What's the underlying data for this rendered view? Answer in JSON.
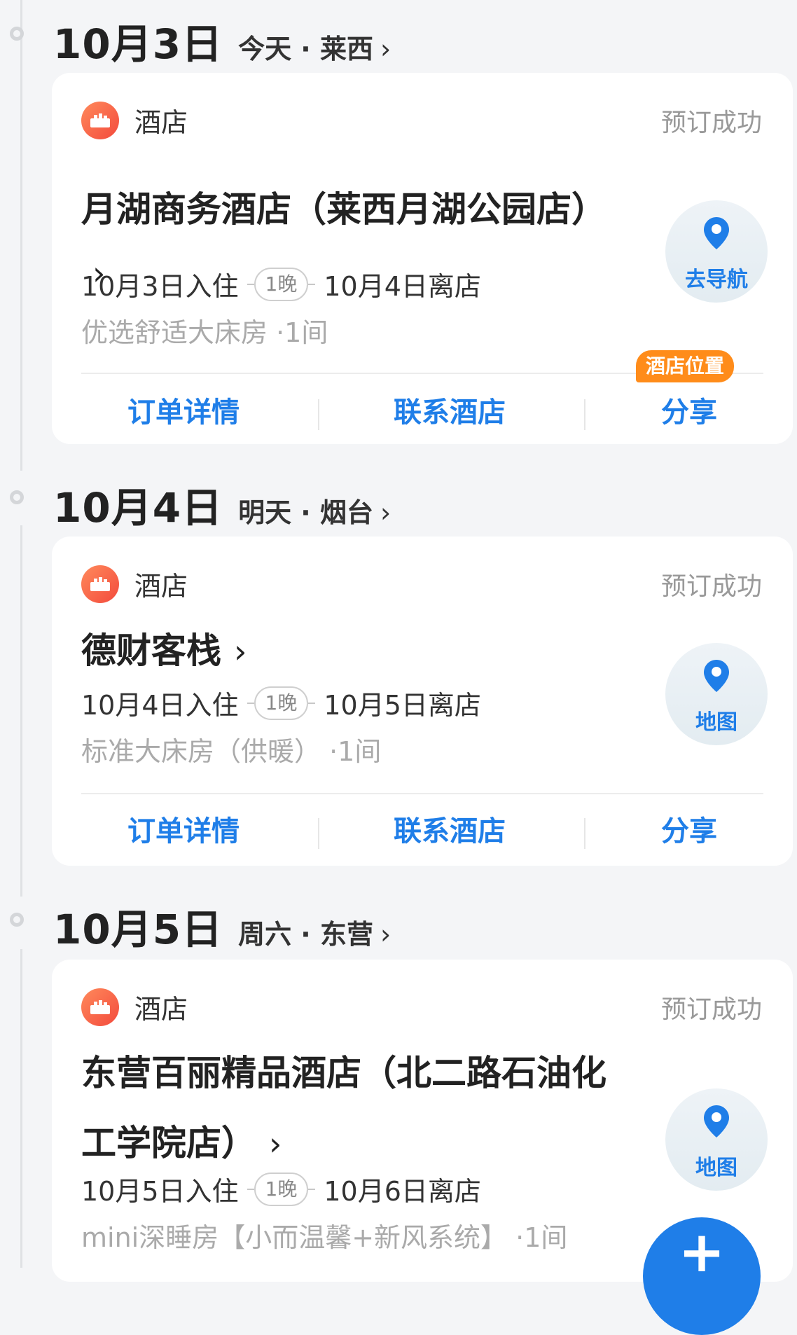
{
  "colors": {
    "accent": "#1f7ee8",
    "badge": "#ff8c1a",
    "hotel_icon": "#f34a3c",
    "status_gray": "#999999"
  },
  "days": [
    {
      "date": "10月3日",
      "sub": "今天 · 莱西",
      "card": {
        "type_label": "酒店",
        "status": "预订成功",
        "hotel_name": "月湖商务酒店（莱西月湖公园店）",
        "checkin": "10月3日入住",
        "nights": "1晚",
        "checkout": "10月4日离店",
        "room": "优选舒适大床房 ·1间",
        "map_label": "去导航",
        "actions": [
          "订单详情",
          "联系酒店",
          "分享"
        ],
        "share_badge": "酒店位置"
      }
    },
    {
      "date": "10月4日",
      "sub": "明天 · 烟台",
      "card": {
        "type_label": "酒店",
        "status": "预订成功",
        "hotel_name": "德财客栈",
        "checkin": "10月4日入住",
        "nights": "1晚",
        "checkout": "10月5日离店",
        "room": "标准大床房（供暖） ·1间",
        "map_label": "地图",
        "actions": [
          "订单详情",
          "联系酒店",
          "分享"
        ]
      }
    },
    {
      "date": "10月5日",
      "sub": "周六 · 东营",
      "card": {
        "type_label": "酒店",
        "status": "预订成功",
        "hotel_name": "东营百丽精品酒店（北二路石油化工学院店）",
        "checkin": "10月5日入住",
        "nights": "1晚",
        "checkout": "10月6日离店",
        "room": "mini深睡房【小而温馨+新风系统】 ·1间",
        "map_label": "地图"
      }
    }
  ],
  "fab": {
    "icon": "plus-icon"
  }
}
